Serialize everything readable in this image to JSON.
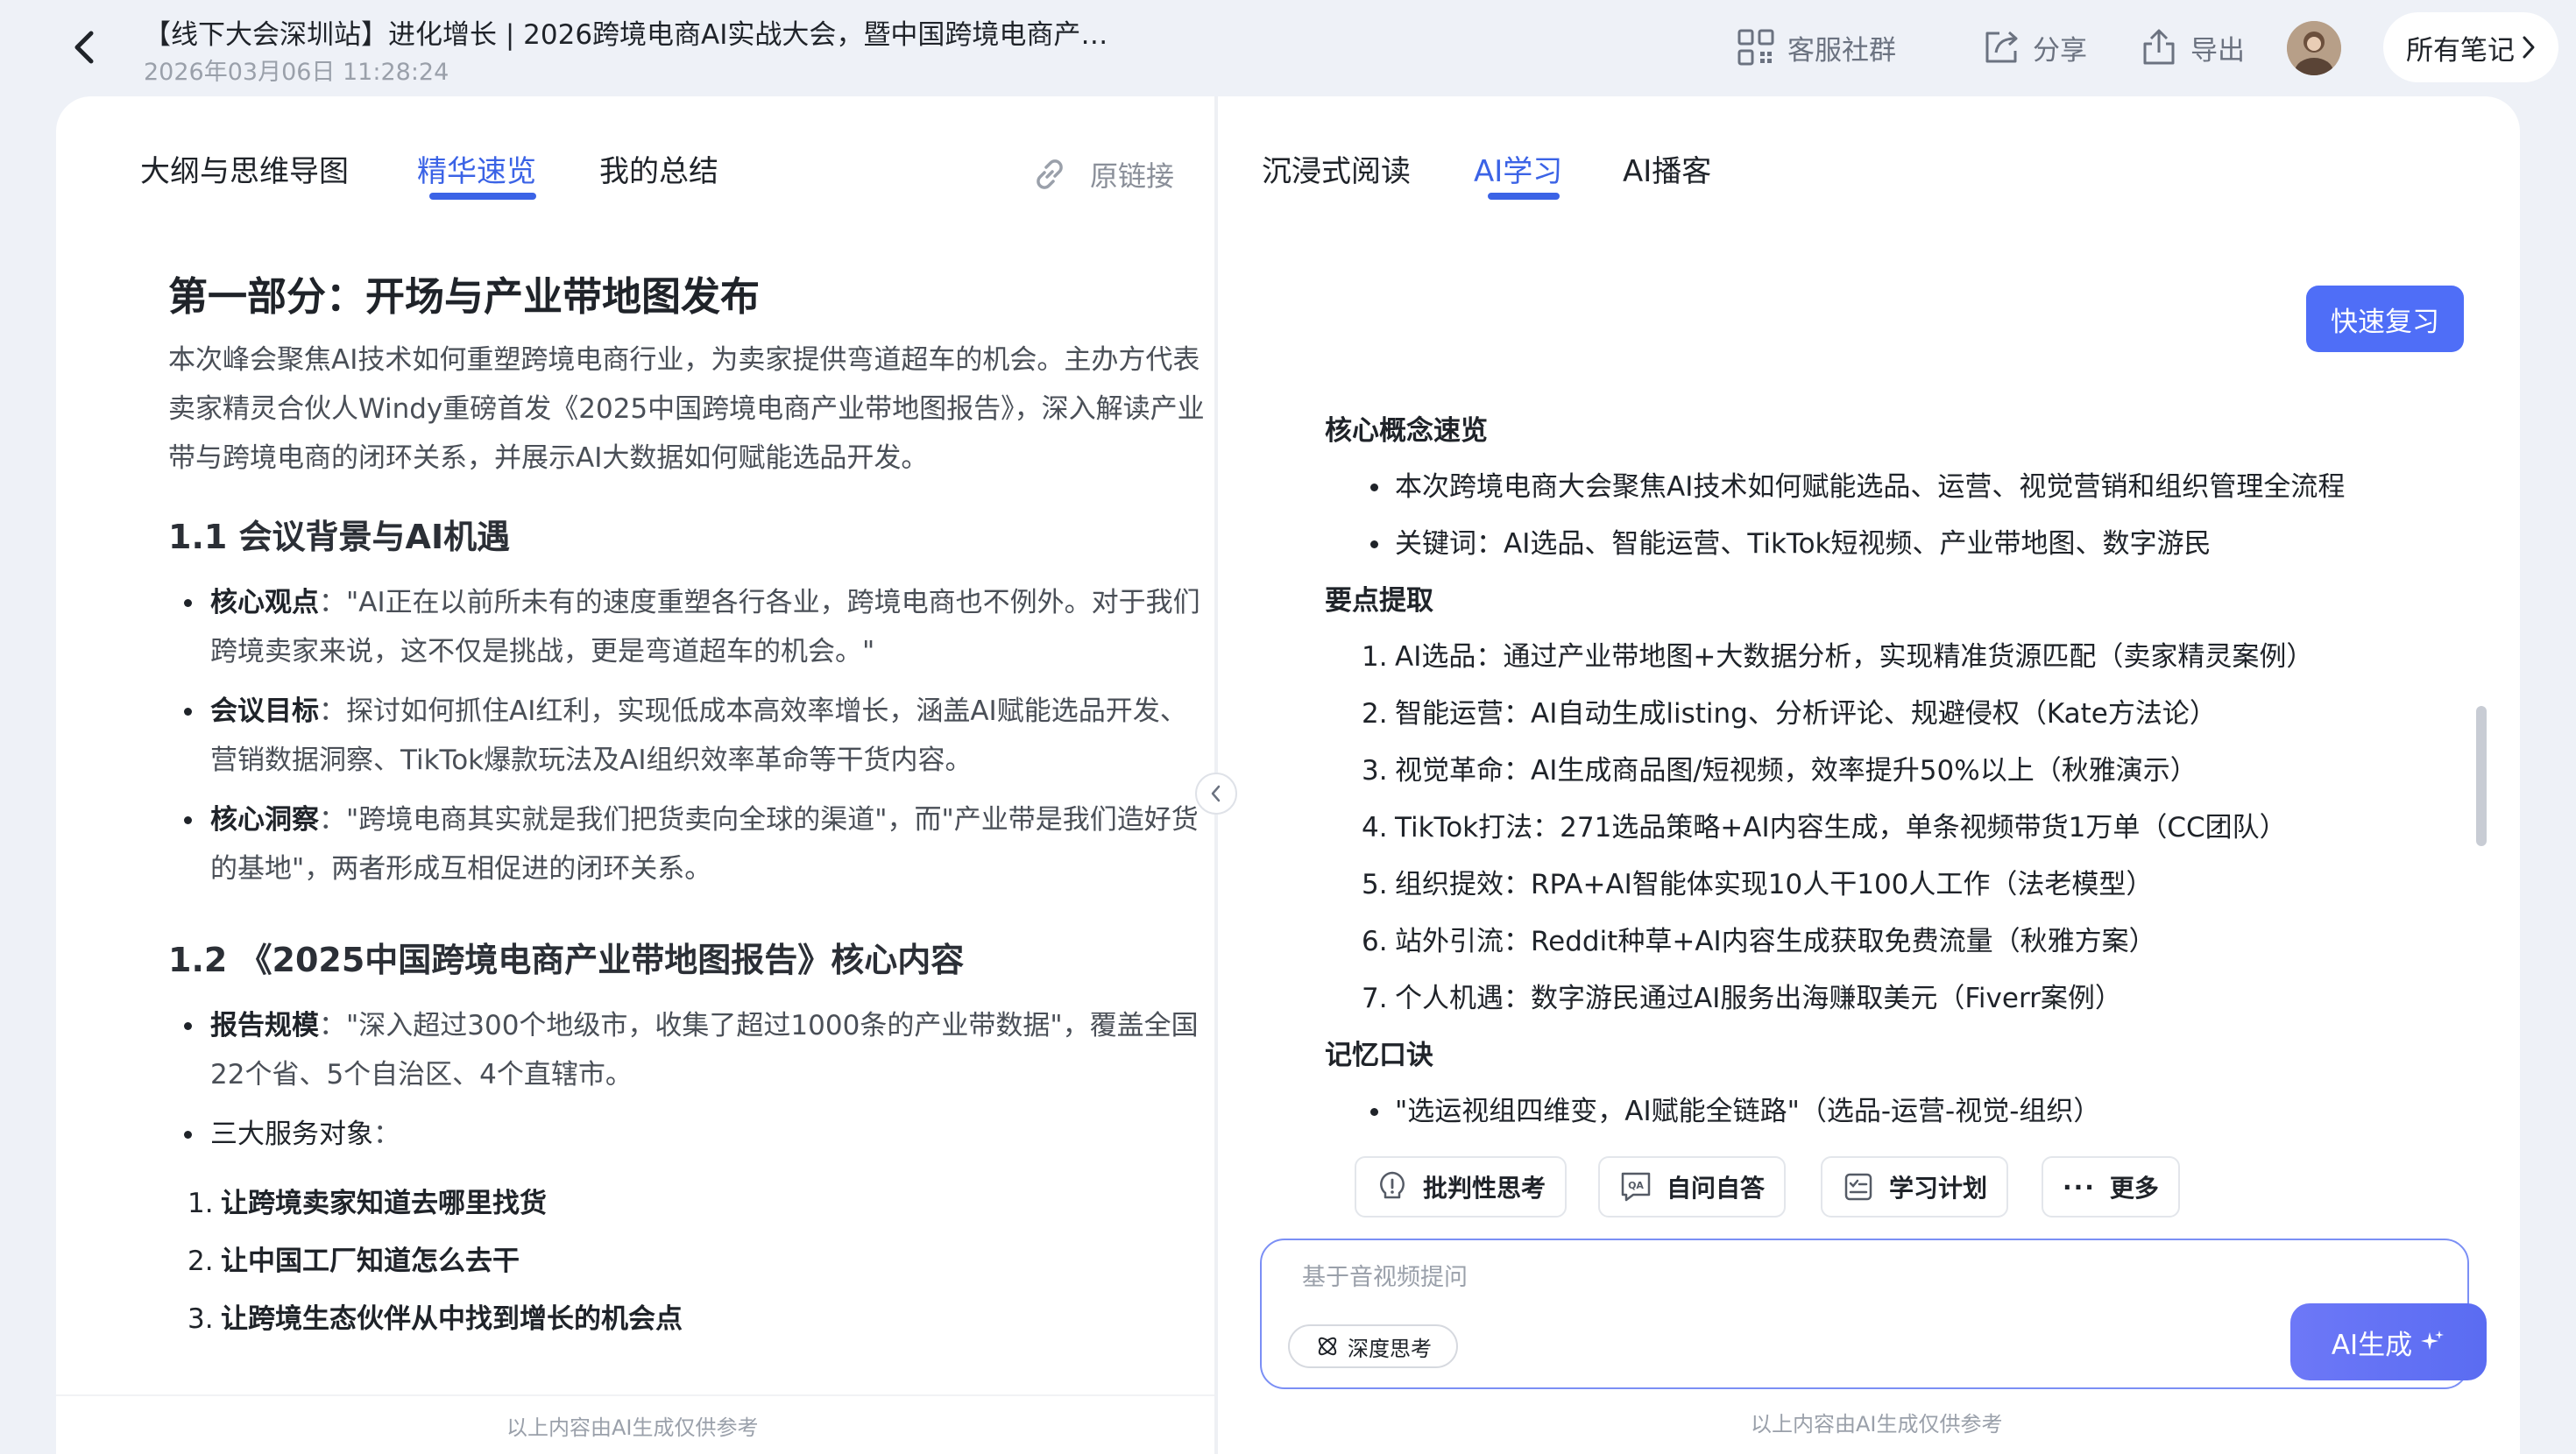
{
  "header": {
    "title": "【线下大会深圳站】进化增长 | 2026跨境电商AI实战大会，暨中国跨境电商产业带地图发布会",
    "timestamp": "2026年03月06日 11:28:24",
    "actions": {
      "service_group": "客服社群",
      "share": "分享",
      "export": "导出"
    },
    "all_notes": "所有笔记"
  },
  "left_panel": {
    "tabs": [
      "大纲与思维导图",
      "精华速览",
      "我的总结"
    ],
    "active_tab": "精华速览",
    "original_link": "原链接",
    "content": {
      "h1": "第一部分：开场与产业带地图发布",
      "intro": "本次峰会聚焦AI技术如何重塑跨境电商行业，为卖家提供弯道超车的机会。主办方代表卖家精灵合伙人Windy重磅首发《2025中国跨境电商产业带地图报告》，深入解读产业带与跨境电商的闭环关系，并展示AI大数据如何赋能选品开发。",
      "s1_title": "1.1 会议背景与AI机遇",
      "s1_items": [
        {
          "label": "核心观点",
          "text": "：\"AI正在以前所未有的速度重塑各行各业，跨境电商也不例外。对于我们跨境卖家来说，这不仅是挑战，更是弯道超车的机会。\""
        },
        {
          "label": "会议目标",
          "text": "：探讨如何抓住AI红利，实现低成本高效率增长，涵盖AI赋能选品开发、营销数据洞察、TikTok爆款玩法及AI组织效率革命等干货内容。"
        },
        {
          "label": "核心洞察",
          "text": "：\"跨境电商其实就是我们把货卖向全球的渠道\"，而\"产业带是我们造好货的基地\"，两者形成互相促进的闭环关系。"
        }
      ],
      "s2_title": "1.2 《2025中国跨境电商产业带地图报告》核心内容",
      "s2_items": [
        {
          "label": "报告规模",
          "text": "：\"深入超过300个地级市，收集了超过1000条的产业带数据\"，覆盖全国22个省、5个自治区、4个直辖市。"
        },
        {
          "label": "三大服务对象",
          "text": "："
        }
      ],
      "s2_numbered": [
        {
          "num": "1.",
          "text": "让跨境卖家知道去哪里找货"
        },
        {
          "num": "2.",
          "text": "让中国工厂知道怎么去干"
        },
        {
          "num": "3.",
          "text": "让跨境生态伙伴从中找到增长的机会点"
        }
      ]
    },
    "footnote": "以上内容由AI生成仅供参考"
  },
  "right_panel": {
    "tabs": [
      "沉浸式阅读",
      "AI学习",
      "AI播客"
    ],
    "active_tab": "AI学习",
    "quick_review": "快速复习",
    "concepts_title": "核心概念速览",
    "concepts": [
      "本次跨境电商大会聚焦AI技术如何赋能选品、运营、视觉营销和组织管理全流程",
      "关键词：AI选品、智能运营、TikTok短视频、产业带地图、数字游民"
    ],
    "points_title": "要点提取",
    "points": [
      {
        "num": "1.",
        "text": "AI选品：通过产业带地图+大数据分析，实现精准货源匹配（卖家精灵案例）"
      },
      {
        "num": "2.",
        "text": "智能运营：AI自动生成listing、分析评论、规避侵权（Kate方法论）"
      },
      {
        "num": "3.",
        "text": "视觉革命：AI生成商品图/短视频，效率提升50%以上（秋雅演示）"
      },
      {
        "num": "4.",
        "text": "TikTok打法：271选品策略+AI内容生成，单条视频带货1万单（CC团队）"
      },
      {
        "num": "5.",
        "text": "组织提效：RPA+AI智能体实现10人干100人工作（法老模型）"
      },
      {
        "num": "6.",
        "text": "站外引流：Reddit种草+AI内容生成获取免费流量（秋雅方案）"
      },
      {
        "num": "7.",
        "text": "个人机遇：数字游民通过AI服务出海赚取美元（Fiverr案例）"
      }
    ],
    "memory_title": "记忆口诀",
    "memory": [
      "\"选运视组四维变，AI赋能全链路\"（选品-运营-视觉-组织）"
    ],
    "chips": {
      "critical": "批判性思考",
      "qa": "自问自答",
      "plan": "学习计划",
      "more": "更多"
    },
    "input": {
      "placeholder": "基于音视频提问",
      "value": "",
      "deep_think": "深度思考",
      "ai_generate": "AI生成"
    },
    "footnote": "以上内容由AI生成仅供参考"
  },
  "colors": {
    "accent": "#3b63e6",
    "button": "#4f6ef7",
    "background": "#eef1f7"
  }
}
